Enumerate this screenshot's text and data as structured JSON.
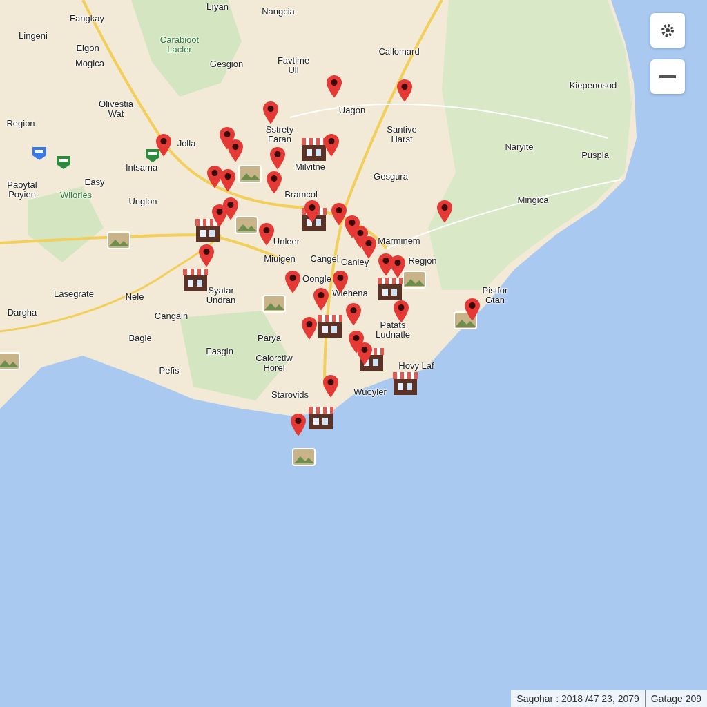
{
  "map": {
    "controls": [
      {
        "kind": "settings"
      },
      {
        "kind": "zoom-out"
      }
    ],
    "labels": [
      {
        "text": "Lıyan",
        "kind": "town"
      },
      {
        "text": "Nangcia",
        "kind": "town"
      },
      {
        "text": "Fangkay",
        "kind": "town"
      },
      {
        "text": "Lingeni",
        "kind": "town"
      },
      {
        "text": "Eigon",
        "kind": "town"
      },
      {
        "text": "Carabioot\nLacler",
        "kind": "park"
      },
      {
        "text": "Mogica",
        "kind": "town"
      },
      {
        "text": "Gesgion",
        "kind": "town"
      },
      {
        "text": "Favtime\nUll",
        "kind": "town"
      },
      {
        "text": "Callomard",
        "kind": "town"
      },
      {
        "text": "Kiepenosod",
        "kind": "town"
      },
      {
        "text": "Olivestia\nWat",
        "kind": "town"
      },
      {
        "text": "Uagon",
        "kind": "town"
      },
      {
        "text": "Region",
        "kind": "town"
      },
      {
        "text": "Sstrety\nFaran",
        "kind": "town"
      },
      {
        "text": "Santive\nHarst",
        "kind": "town"
      },
      {
        "text": "Jolla",
        "kind": "town"
      },
      {
        "text": "Naryite",
        "kind": "town"
      },
      {
        "text": "Puspia",
        "kind": "town"
      },
      {
        "text": "Intsama",
        "kind": "town"
      },
      {
        "text": "Milvitne",
        "kind": "town"
      },
      {
        "text": "Gesgura",
        "kind": "town"
      },
      {
        "text": "Easy",
        "kind": "town"
      },
      {
        "text": "Paoytal\nPoyien",
        "kind": "town"
      },
      {
        "text": "Wilories",
        "kind": "park"
      },
      {
        "text": "Bramcol",
        "kind": "town"
      },
      {
        "text": "Mingica",
        "kind": "town"
      },
      {
        "text": "Unglon",
        "kind": "town"
      },
      {
        "text": "Marminem",
        "kind": "town"
      },
      {
        "text": "Unleer",
        "kind": "town"
      },
      {
        "text": "Miuigen",
        "kind": "town"
      },
      {
        "text": "Cangel",
        "kind": "town"
      },
      {
        "text": "Canley",
        "kind": "town"
      },
      {
        "text": "Regjon",
        "kind": "town"
      },
      {
        "text": "Oongle",
        "kind": "town"
      },
      {
        "text": "Lasegrate",
        "kind": "town"
      },
      {
        "text": "Nele",
        "kind": "town"
      },
      {
        "text": "Syatar\nUndran",
        "kind": "town"
      },
      {
        "text": "Wiehena",
        "kind": "town"
      },
      {
        "text": "Pistfor\nGtan",
        "kind": "town"
      },
      {
        "text": "Dargha",
        "kind": "town"
      },
      {
        "text": "Cangain",
        "kind": "town"
      },
      {
        "text": "Patats\nLudnatle",
        "kind": "town"
      },
      {
        "text": "Bagle",
        "kind": "town"
      },
      {
        "text": "Parya",
        "kind": "town"
      },
      {
        "text": "Easgin",
        "kind": "town"
      },
      {
        "text": "Calorctiw\nHorel",
        "kind": "town"
      },
      {
        "text": "Hovy Laf",
        "kind": "town"
      },
      {
        "text": "Pefis",
        "kind": "town"
      },
      {
        "text": "Wuoyler",
        "kind": "town"
      },
      {
        "text": "Starovids",
        "kind": "town"
      }
    ],
    "markers": [
      {
        "kind": "shield"
      },
      {
        "kind": "shield"
      },
      {
        "kind": "shield"
      },
      {
        "kind": "photo"
      },
      {
        "kind": "photo"
      },
      {
        "kind": "photo"
      },
      {
        "kind": "photo"
      },
      {
        "kind": "photo"
      },
      {
        "kind": "photo"
      },
      {
        "kind": "photo"
      },
      {
        "kind": "photo"
      },
      {
        "kind": "shop"
      },
      {
        "kind": "shop"
      },
      {
        "kind": "shop"
      },
      {
        "kind": "shop"
      },
      {
        "kind": "shop"
      },
      {
        "kind": "shop"
      },
      {
        "kind": "shop"
      },
      {
        "kind": "shop"
      },
      {
        "kind": "shop"
      },
      {
        "kind": "pin"
      },
      {
        "kind": "pin"
      },
      {
        "kind": "pin"
      },
      {
        "kind": "pin"
      },
      {
        "kind": "pin"
      },
      {
        "kind": "pin"
      },
      {
        "kind": "pin"
      },
      {
        "kind": "pin"
      },
      {
        "kind": "pin"
      },
      {
        "kind": "pin"
      },
      {
        "kind": "pin"
      },
      {
        "kind": "pin"
      },
      {
        "kind": "pin"
      },
      {
        "kind": "pin"
      },
      {
        "kind": "pin"
      },
      {
        "kind": "pin"
      },
      {
        "kind": "pin"
      },
      {
        "kind": "pin"
      },
      {
        "kind": "pin"
      },
      {
        "kind": "pin"
      },
      {
        "kind": "pin"
      },
      {
        "kind": "pin"
      },
      {
        "kind": "pin"
      },
      {
        "kind": "pin"
      },
      {
        "kind": "pin"
      },
      {
        "kind": "pin"
      },
      {
        "kind": "pin"
      },
      {
        "kind": "pin"
      },
      {
        "kind": "pin"
      },
      {
        "kind": "pin"
      },
      {
        "kind": "pin"
      },
      {
        "kind": "pin"
      },
      {
        "kind": "pin"
      },
      {
        "kind": "pin"
      }
    ],
    "attribution": [
      "Sagohar : 2018 /47 23, 2079",
      "Gatage 209"
    ]
  }
}
